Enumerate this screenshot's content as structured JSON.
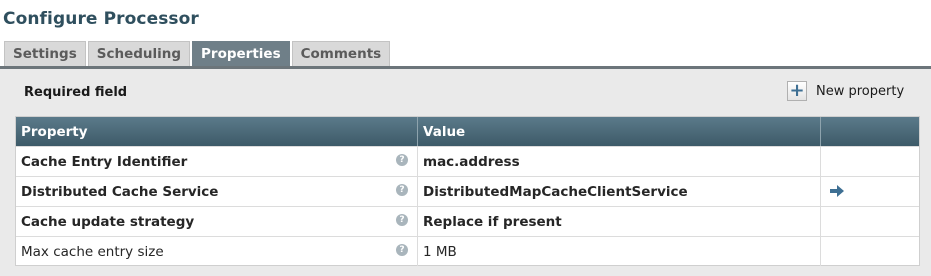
{
  "dialog": {
    "title": "Configure Processor"
  },
  "tabs": [
    {
      "label": "Settings",
      "active": false
    },
    {
      "label": "Scheduling",
      "active": false
    },
    {
      "label": "Properties",
      "active": true
    },
    {
      "label": "Comments",
      "active": false
    }
  ],
  "toolbar": {
    "required_label": "Required field",
    "new_property_label": "New property",
    "new_property_icon": "plus-icon"
  },
  "table": {
    "headers": [
      "Property",
      "Value",
      ""
    ],
    "rows": [
      {
        "property": "Cache Entry Identifier",
        "value": "mac.address",
        "required": true,
        "has_action": false
      },
      {
        "property": "Distributed Cache Service",
        "value": "DistributedMapCacheClientService",
        "required": true,
        "has_action": true
      },
      {
        "property": "Cache update strategy",
        "value": "Replace if present",
        "required": true,
        "has_action": false
      },
      {
        "property": "Max cache entry size",
        "value": "1 MB",
        "required": false,
        "has_action": false
      }
    ]
  },
  "icons": {
    "help": "help-icon",
    "goto": "arrow-right-icon"
  },
  "colors": {
    "title": "#2f4f5e",
    "header": "#4a6a79",
    "active_tab": "#6f7f88"
  }
}
